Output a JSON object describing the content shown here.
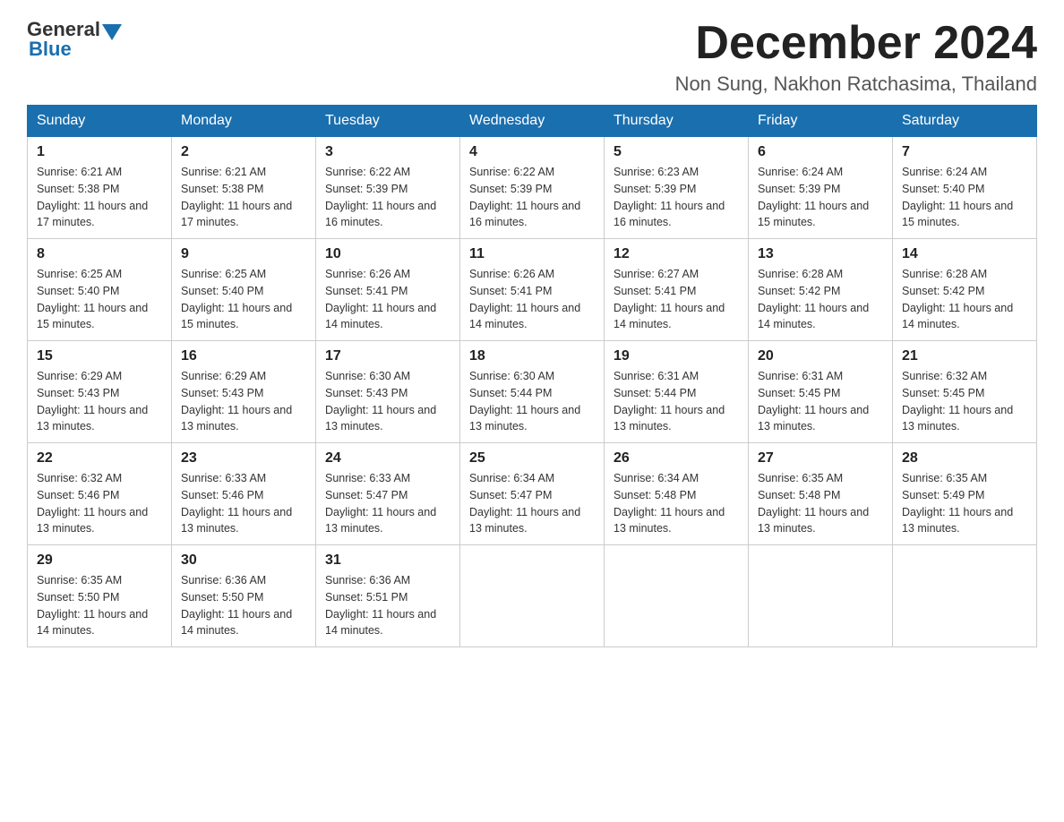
{
  "logo": {
    "text_general": "General",
    "text_blue": "Blue"
  },
  "title": {
    "month_year": "December 2024",
    "location": "Non Sung, Nakhon Ratchasima, Thailand"
  },
  "headers": [
    "Sunday",
    "Monday",
    "Tuesday",
    "Wednesday",
    "Thursday",
    "Friday",
    "Saturday"
  ],
  "weeks": [
    [
      {
        "day": "1",
        "sunrise": "6:21 AM",
        "sunset": "5:38 PM",
        "daylight": "11 hours and 17 minutes."
      },
      {
        "day": "2",
        "sunrise": "6:21 AM",
        "sunset": "5:38 PM",
        "daylight": "11 hours and 17 minutes."
      },
      {
        "day": "3",
        "sunrise": "6:22 AM",
        "sunset": "5:39 PM",
        "daylight": "11 hours and 16 minutes."
      },
      {
        "day": "4",
        "sunrise": "6:22 AM",
        "sunset": "5:39 PM",
        "daylight": "11 hours and 16 minutes."
      },
      {
        "day": "5",
        "sunrise": "6:23 AM",
        "sunset": "5:39 PM",
        "daylight": "11 hours and 16 minutes."
      },
      {
        "day": "6",
        "sunrise": "6:24 AM",
        "sunset": "5:39 PM",
        "daylight": "11 hours and 15 minutes."
      },
      {
        "day": "7",
        "sunrise": "6:24 AM",
        "sunset": "5:40 PM",
        "daylight": "11 hours and 15 minutes."
      }
    ],
    [
      {
        "day": "8",
        "sunrise": "6:25 AM",
        "sunset": "5:40 PM",
        "daylight": "11 hours and 15 minutes."
      },
      {
        "day": "9",
        "sunrise": "6:25 AM",
        "sunset": "5:40 PM",
        "daylight": "11 hours and 15 minutes."
      },
      {
        "day": "10",
        "sunrise": "6:26 AM",
        "sunset": "5:41 PM",
        "daylight": "11 hours and 14 minutes."
      },
      {
        "day": "11",
        "sunrise": "6:26 AM",
        "sunset": "5:41 PM",
        "daylight": "11 hours and 14 minutes."
      },
      {
        "day": "12",
        "sunrise": "6:27 AM",
        "sunset": "5:41 PM",
        "daylight": "11 hours and 14 minutes."
      },
      {
        "day": "13",
        "sunrise": "6:28 AM",
        "sunset": "5:42 PM",
        "daylight": "11 hours and 14 minutes."
      },
      {
        "day": "14",
        "sunrise": "6:28 AM",
        "sunset": "5:42 PM",
        "daylight": "11 hours and 14 minutes."
      }
    ],
    [
      {
        "day": "15",
        "sunrise": "6:29 AM",
        "sunset": "5:43 PM",
        "daylight": "11 hours and 13 minutes."
      },
      {
        "day": "16",
        "sunrise": "6:29 AM",
        "sunset": "5:43 PM",
        "daylight": "11 hours and 13 minutes."
      },
      {
        "day": "17",
        "sunrise": "6:30 AM",
        "sunset": "5:43 PM",
        "daylight": "11 hours and 13 minutes."
      },
      {
        "day": "18",
        "sunrise": "6:30 AM",
        "sunset": "5:44 PM",
        "daylight": "11 hours and 13 minutes."
      },
      {
        "day": "19",
        "sunrise": "6:31 AM",
        "sunset": "5:44 PM",
        "daylight": "11 hours and 13 minutes."
      },
      {
        "day": "20",
        "sunrise": "6:31 AM",
        "sunset": "5:45 PM",
        "daylight": "11 hours and 13 minutes."
      },
      {
        "day": "21",
        "sunrise": "6:32 AM",
        "sunset": "5:45 PM",
        "daylight": "11 hours and 13 minutes."
      }
    ],
    [
      {
        "day": "22",
        "sunrise": "6:32 AM",
        "sunset": "5:46 PM",
        "daylight": "11 hours and 13 minutes."
      },
      {
        "day": "23",
        "sunrise": "6:33 AM",
        "sunset": "5:46 PM",
        "daylight": "11 hours and 13 minutes."
      },
      {
        "day": "24",
        "sunrise": "6:33 AM",
        "sunset": "5:47 PM",
        "daylight": "11 hours and 13 minutes."
      },
      {
        "day": "25",
        "sunrise": "6:34 AM",
        "sunset": "5:47 PM",
        "daylight": "11 hours and 13 minutes."
      },
      {
        "day": "26",
        "sunrise": "6:34 AM",
        "sunset": "5:48 PM",
        "daylight": "11 hours and 13 minutes."
      },
      {
        "day": "27",
        "sunrise": "6:35 AM",
        "sunset": "5:48 PM",
        "daylight": "11 hours and 13 minutes."
      },
      {
        "day": "28",
        "sunrise": "6:35 AM",
        "sunset": "5:49 PM",
        "daylight": "11 hours and 13 minutes."
      }
    ],
    [
      {
        "day": "29",
        "sunrise": "6:35 AM",
        "sunset": "5:50 PM",
        "daylight": "11 hours and 14 minutes."
      },
      {
        "day": "30",
        "sunrise": "6:36 AM",
        "sunset": "5:50 PM",
        "daylight": "11 hours and 14 minutes."
      },
      {
        "day": "31",
        "sunrise": "6:36 AM",
        "sunset": "5:51 PM",
        "daylight": "11 hours and 14 minutes."
      },
      null,
      null,
      null,
      null
    ]
  ]
}
